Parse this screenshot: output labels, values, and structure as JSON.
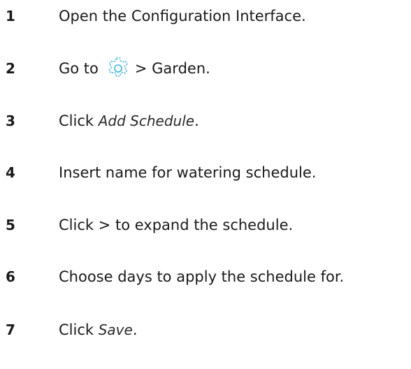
{
  "steps": [
    {
      "number": "1",
      "text": "Open the Configuration Interface."
    },
    {
      "number": "2",
      "prefix": "Go to",
      "icon": "gear-icon",
      "suffix": "> Garden."
    },
    {
      "number": "3",
      "prefix": "Click ",
      "emphasis": "Add Schedule",
      "suffix": "."
    },
    {
      "number": "4",
      "text": "Insert name for watering schedule."
    },
    {
      "number": "5",
      "text": "Click > to expand the schedule."
    },
    {
      "number": "6",
      "text": "Choose days to apply the schedule for."
    },
    {
      "number": "7",
      "prefix": "Click ",
      "emphasis": "Save",
      "suffix": "."
    }
  ],
  "colors": {
    "text": "#1a1a1a",
    "icon": "#35b5e8"
  }
}
